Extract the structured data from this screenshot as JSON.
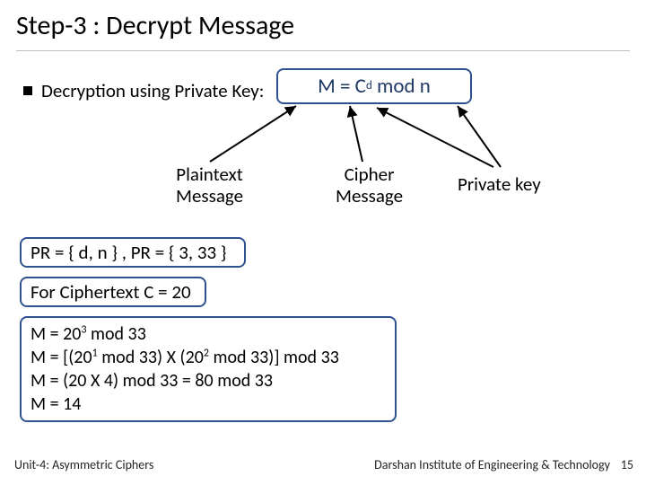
{
  "title": "Step-3 : Decrypt Message",
  "bullet": {
    "lead": "Decryption using Private Key:"
  },
  "formula": {
    "lhs": "M",
    "eq": "=",
    "cvar": "C",
    "exp": "d",
    "mod": "mod",
    "nvar": "n"
  },
  "annotations": {
    "plaintext_l1": "Plaintext",
    "plaintext_l2": "Message",
    "cipher_l1": "Cipher",
    "cipher_l2": "Message",
    "private": "Private key"
  },
  "boxes": {
    "pr": "PR = { d, n } , PR = { 3, 33 }",
    "c": "For Ciphertext C = 20"
  },
  "calc": {
    "l1_a": "M = 20",
    "l1_exp": "3",
    "l1_b": " mod 33",
    "l2_a": "M = [(20",
    "l2_e1": "1",
    "l2_b": " mod 33) X (20",
    "l2_e2": "2",
    "l2_c": " mod 33)] mod 33",
    "l3": "M = (20 X 4) mod 33 = 80 mod 33",
    "l4": "M = 14"
  },
  "footer": {
    "left": "Unit-4: Asymmetric Ciphers",
    "right": "Darshan Institute of Engineering & Technology",
    "page": "15"
  }
}
